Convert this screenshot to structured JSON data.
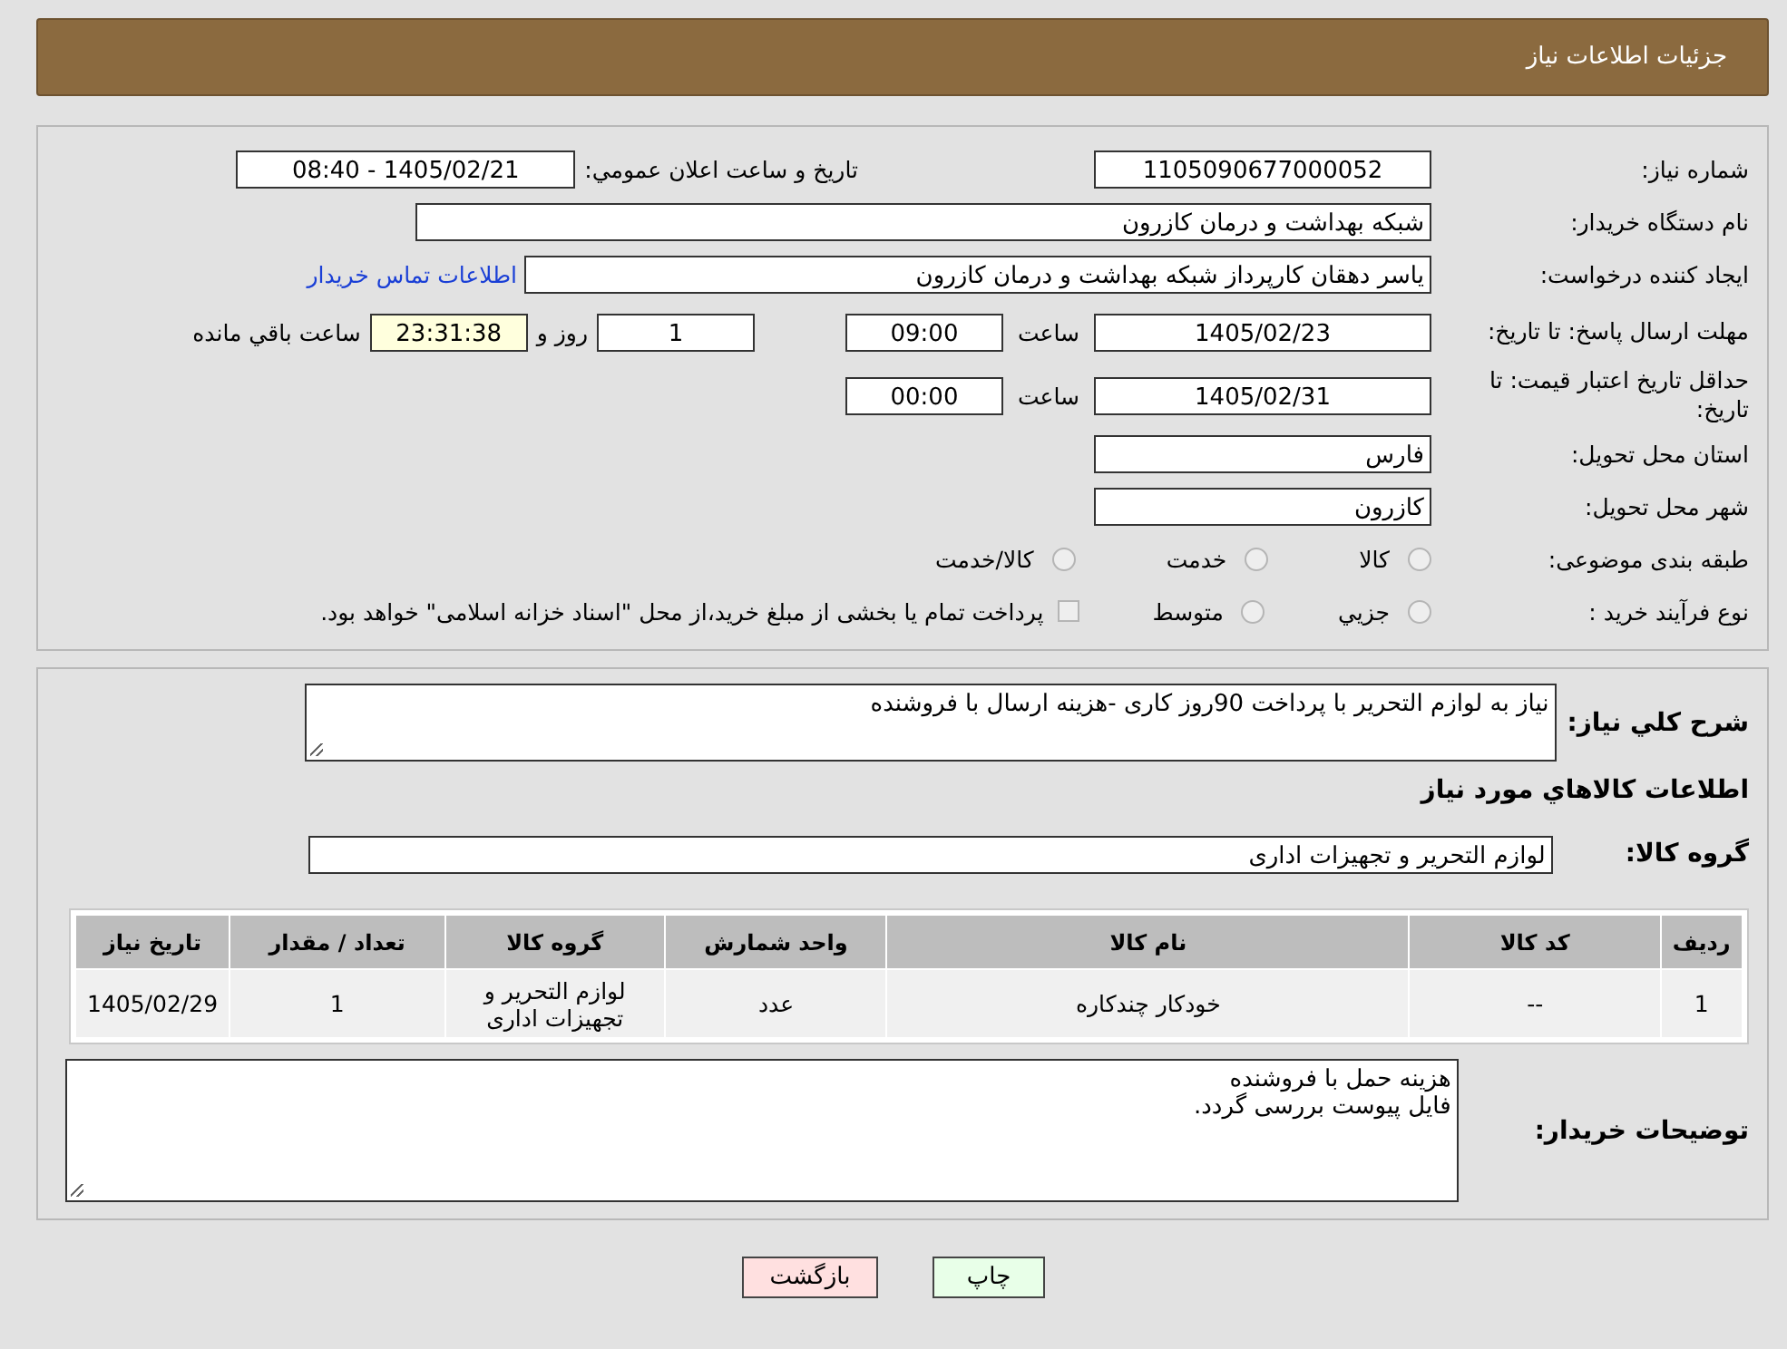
{
  "header": {
    "title": "جزئیات اطلاعات نیاز"
  },
  "need_number": {
    "label": "شماره نیاز:",
    "value": "1105090677000052"
  },
  "announce": {
    "label": "تاریخ و ساعت اعلان عمومي:",
    "value": "1405/02/21 - 08:40"
  },
  "buyer_org": {
    "label": "نام دستگاه خریدار:",
    "value": "شبکه بهداشت و درمان کازرون"
  },
  "creator": {
    "label": "ایجاد کننده درخواست:",
    "value": "یاسر دهقان کارپرداز شبکه بهداشت و درمان کازرون",
    "link": "اطلاعات تماس خریدار"
  },
  "deadline": {
    "label": "مهلت ارسال پاسخ: تا تاریخ:",
    "date": "1405/02/23",
    "time_label": "ساعت",
    "time": "09:00",
    "days": "1",
    "days_label": "روز و",
    "remaining": "23:31:38",
    "remaining_label": "ساعت باقي مانده"
  },
  "price_validity": {
    "label": "حداقل تاریخ اعتبار قیمت: تا تاریخ:",
    "date": "1405/02/31",
    "time_label": "ساعت",
    "time": "00:00"
  },
  "province": {
    "label": "استان محل تحویل:",
    "value": "فارس"
  },
  "city": {
    "label": "شهر محل تحویل:",
    "value": "کازرون"
  },
  "category": {
    "label": "طبقه بندی موضوعی:",
    "options": [
      {
        "kind": "radio",
        "label": "کالا",
        "selected": false
      },
      {
        "kind": "radio",
        "label": "خدمت",
        "selected": false
      },
      {
        "kind": "radio",
        "label": "کالا/خدمت",
        "selected": false
      }
    ]
  },
  "purchase_type": {
    "label": "نوع فرآیند خرید :",
    "options": [
      {
        "kind": "radio",
        "label": "جزيي",
        "selected": false
      },
      {
        "kind": "radio",
        "label": "متوسط",
        "selected": false
      },
      {
        "kind": "checkbox",
        "label": "پرداخت تمام یا بخشی از مبلغ خرید،از محل \"اسناد خزانه اسلامی\" خواهد بود.",
        "selected": false
      }
    ]
  },
  "description": {
    "label": "شرح کلي نیاز:",
    "value": "نیاز به لوازم التحریر با پرداخت 90روز کاری -هزینه ارسال با فروشنده"
  },
  "goods_title": "اطلاعات کالاهاي مورد نیاز",
  "goods_group": {
    "label": "گروه کالا:",
    "value": "لوازم التحریر و تجهیزات اداری"
  },
  "table": {
    "columns": [
      "ردیف",
      "کد کالا",
      "نام کالا",
      "واحد شمارش",
      "گروه کالا",
      "تعداد / مقدار",
      "تاریخ نیاز"
    ],
    "rows": [
      [
        "1",
        "--",
        "خودکار چندکاره",
        "عدد",
        "لوازم التحریر و تجهیزات اداری",
        "1",
        "1405/02/29"
      ]
    ]
  },
  "buyer_notes": {
    "label": "توضیحات خریدار:",
    "value": "هزینه حمل با فروشنده\nفایل پیوست بررسی گردد."
  },
  "buttons": [
    {
      "kind": "print",
      "label": "چاپ"
    },
    {
      "kind": "back",
      "label": "بازگشت"
    }
  ]
}
